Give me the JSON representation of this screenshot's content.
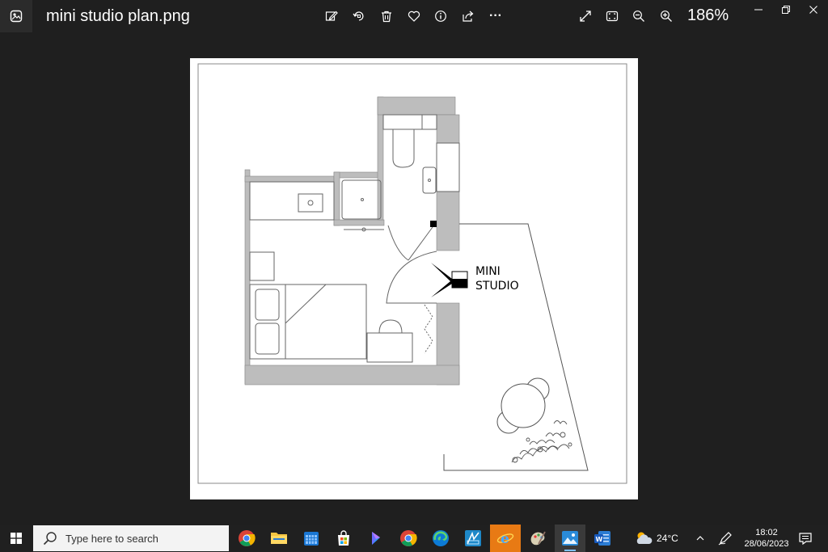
{
  "window": {
    "title": "mini studio plan.png",
    "zoom": "186%",
    "toolbar_icons": [
      "edit-icon",
      "rotate-icon",
      "delete-icon",
      "favorite-icon",
      "info-icon",
      "share-icon",
      "more-icon"
    ],
    "view_icons": [
      "fullscreen-icon",
      "fit-icon",
      "zoom-out-icon",
      "zoom-in-icon"
    ],
    "more_label": "···",
    "controls": [
      "minimize",
      "restore",
      "close"
    ]
  },
  "plan": {
    "label_line1": "MINI",
    "label_line2": "STUDIO"
  },
  "taskbar": {
    "search_placeholder": "Type here to search",
    "apps": [
      "chrome",
      "file-explorer",
      "calendar",
      "store",
      "copilot",
      "chrome",
      "edge",
      "paint",
      "internet-explorer",
      "paint-tool",
      "photos",
      "word"
    ],
    "weather_temp": "24°C",
    "time": "18:02",
    "date": "28/06/2023"
  }
}
